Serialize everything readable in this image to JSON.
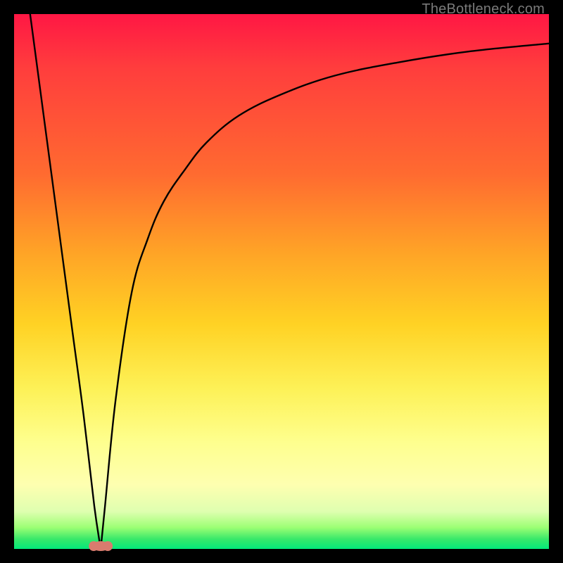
{
  "watermark": "TheBottleneck.com",
  "chart_data": {
    "type": "line",
    "title": "",
    "xlabel": "",
    "ylabel": "",
    "xlim": [
      0,
      100
    ],
    "ylim": [
      0,
      100
    ],
    "grid": false,
    "legend": false,
    "annotations": [],
    "description": "V-shaped bottleneck curve with minimum near x≈16; left branch descends from top-left corner steeply to the minimum; right branch rises asymptotically toward y≈95 at the right edge. Background is a vertical red→green heatmap (0% bottleneck at bottom).",
    "series": [
      {
        "name": "left-branch",
        "x": [
          3,
          5,
          7,
          9,
          11,
          13,
          15,
          16.2
        ],
        "values": [
          100,
          85,
          70,
          55,
          40,
          25,
          8,
          0
        ]
      },
      {
        "name": "right-branch",
        "x": [
          16.2,
          17,
          19,
          22,
          25,
          28,
          32,
          36,
          42,
          50,
          60,
          72,
          85,
          100
        ],
        "values": [
          0,
          8,
          28,
          48,
          58,
          65,
          71,
          76,
          81,
          85,
          88.5,
          91,
          93,
          94.5
        ]
      }
    ],
    "marker": {
      "x": 16.2,
      "y": 0
    },
    "background_gradient_stops": [
      {
        "pct": 0,
        "color": "#ff1744"
      },
      {
        "pct": 50,
        "color": "#ffc224"
      },
      {
        "pct": 80,
        "color": "#feff8e"
      },
      {
        "pct": 100,
        "color": "#00e87a"
      }
    ]
  }
}
